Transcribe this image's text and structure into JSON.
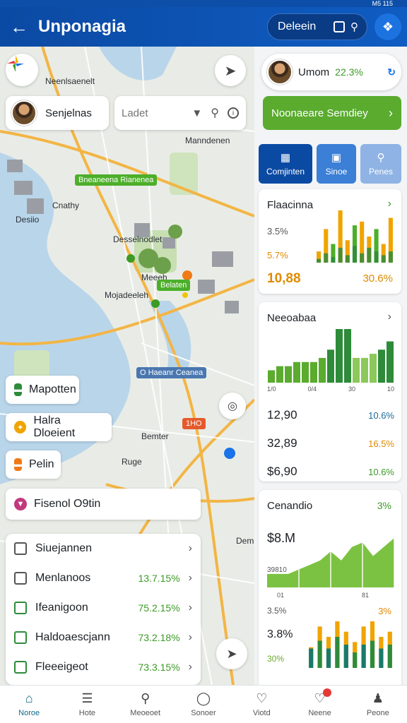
{
  "status": {
    "text": "M5 115"
  },
  "header": {
    "title": "Unponagia",
    "pill_label": "Deleein"
  },
  "map": {
    "user_chip": {
      "label": "Senjelnas"
    },
    "search": {
      "placeholder": "Ladet"
    },
    "labels": {
      "n1": "Neenlsaenelt",
      "n2": "Manndenen",
      "n3": "Cnathy",
      "n4": "Desiio",
      "n5": "Desselnodlet",
      "n6": "Meeeh",
      "n7": "Mojadeeleh",
      "n8": "Bemter",
      "n9": "Ruge",
      "n10": "Demei"
    },
    "tags": {
      "t1": "Bneaneena Rianenea",
      "t2": "Belaten",
      "t3": "O Haeanr Ceanea",
      "t4": "1HO"
    },
    "chips": [
      {
        "label": "Mapotten",
        "color": "#2e8b3a"
      },
      {
        "label": "Halra Dloeient",
        "color": "#f0a400"
      },
      {
        "label": "Pelin",
        "color": "#f07a16"
      },
      {
        "label": "Fisenol O9tin",
        "color": "#c2387e"
      }
    ],
    "list": [
      {
        "label": "Siuejannen",
        "pct": ""
      },
      {
        "label": "Menlanoos",
        "pct": "13.7.15%"
      },
      {
        "label": "Ifeanigoon",
        "pct": "75.2.15%"
      },
      {
        "label": "Haldoaescjann",
        "pct": "73.2.18%"
      },
      {
        "label": "Fleeeigeot",
        "pct": "73.3.15%"
      }
    ]
  },
  "right": {
    "profile": {
      "name": "Umom",
      "score": "22.3%"
    },
    "cta": {
      "label": "Noonaeare Semdiey"
    },
    "actions": [
      {
        "label": "Comjinten"
      },
      {
        "label": "Sinoe"
      },
      {
        "label": "Penes"
      }
    ],
    "card1": {
      "title": "Flaacinna",
      "stat_a": "3.5%",
      "stat_b": "5.7%",
      "value": "10,88",
      "pct": "30.6%"
    },
    "card2": {
      "title": "Neeoabaa",
      "axis": [
        "1/0",
        "0/4",
        "30",
        "10"
      ],
      "rows": [
        {
          "value": "12,90",
          "pct": "10.6%",
          "color": "#1a6b9a"
        },
        {
          "value": "32,89",
          "pct": "16.5%",
          "color": "#e08a00"
        },
        {
          "value": "$6,90",
          "pct": "10.6%",
          "color": "#3c9a26"
        }
      ]
    },
    "card3": {
      "title": "Cenandio",
      "pct": "3%",
      "value": "$8.M",
      "sub": "39810",
      "axis": [
        "01",
        "81"
      ],
      "stat_a": "3.5%",
      "stat_b": "3%",
      "value2": "3.8%",
      "value3": "30%"
    }
  },
  "chart_data": [
    {
      "type": "bar",
      "title": "Flaacinna",
      "series": [
        {
          "values": [
            3,
            9,
            5,
            14,
            6,
            10,
            11,
            7,
            9,
            5,
            12
          ]
        },
        {
          "values": [
            2,
            5,
            3,
            8,
            4,
            9,
            5,
            8,
            6,
            4,
            6
          ]
        }
      ]
    },
    {
      "type": "bar",
      "title": "Neeoabaa",
      "values": [
        3,
        4,
        4,
        5,
        5,
        5,
        6,
        8,
        13,
        13,
        6,
        6,
        7,
        8,
        10
      ]
    },
    {
      "type": "area",
      "title": "Cenandio",
      "values": [
        3,
        3,
        3,
        4,
        5,
        6,
        8,
        6,
        9,
        10,
        7,
        9,
        11
      ]
    },
    {
      "type": "bar",
      "series": [
        {
          "values": [
            4,
            8,
            6,
            9,
            7,
            5,
            8,
            9,
            6,
            7
          ]
        },
        {
          "values": [
            5,
            7,
            5,
            8,
            6,
            4,
            6,
            7,
            5,
            6
          ]
        }
      ]
    }
  ],
  "nav": [
    {
      "label": "Noroe",
      "icon": "home-icon",
      "active": true
    },
    {
      "label": "Hote",
      "icon": "list-icon"
    },
    {
      "label": "Meoeoet",
      "icon": "search-icon"
    },
    {
      "label": "Sonoer",
      "icon": "compass-icon"
    },
    {
      "label": "Viotd",
      "icon": "heart-icon"
    },
    {
      "label": "Neene",
      "icon": "bell-icon",
      "badge": true
    },
    {
      "label": "Peone",
      "icon": "person-icon"
    }
  ]
}
